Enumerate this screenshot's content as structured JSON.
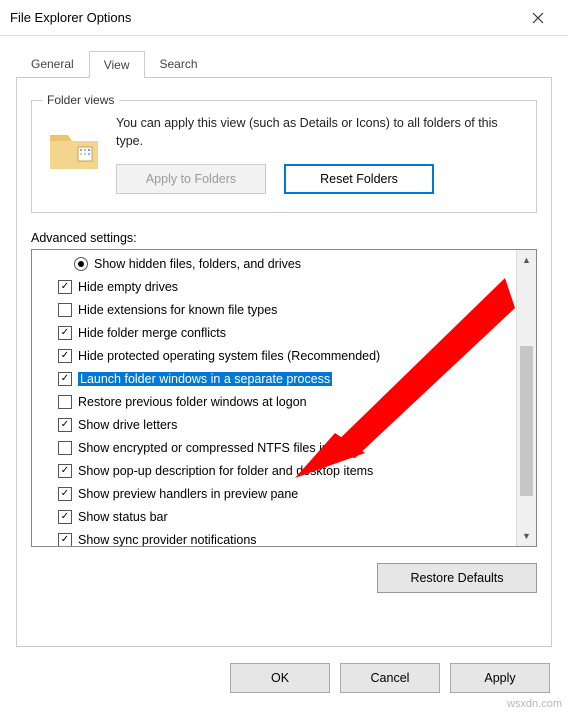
{
  "window": {
    "title": "File Explorer Options"
  },
  "tabs": {
    "general": "General",
    "view": "View",
    "search": "Search",
    "active": "view"
  },
  "folderViews": {
    "title": "Folder views",
    "text": "You can apply this view (such as Details or Icons) to all folders of this type.",
    "applyBtn": "Apply to Folders",
    "resetBtn": "Reset Folders"
  },
  "advanced": {
    "label": "Advanced settings:",
    "items": [
      {
        "kind": "radio",
        "checked": true,
        "label": "Show hidden files, folders, and drives",
        "selected": false
      },
      {
        "kind": "check",
        "checked": true,
        "label": "Hide empty drives",
        "selected": false
      },
      {
        "kind": "check",
        "checked": false,
        "label": "Hide extensions for known file types",
        "selected": false
      },
      {
        "kind": "check",
        "checked": true,
        "label": "Hide folder merge conflicts",
        "selected": false
      },
      {
        "kind": "check",
        "checked": true,
        "label": "Hide protected operating system files (Recommended)",
        "selected": false
      },
      {
        "kind": "check",
        "checked": true,
        "label": "Launch folder windows in a separate process",
        "selected": true
      },
      {
        "kind": "check",
        "checked": false,
        "label": "Restore previous folder windows at logon",
        "selected": false
      },
      {
        "kind": "check",
        "checked": true,
        "label": "Show drive letters",
        "selected": false
      },
      {
        "kind": "check",
        "checked": false,
        "label": "Show encrypted or compressed NTFS files in color",
        "selected": false
      },
      {
        "kind": "check",
        "checked": true,
        "label": "Show pop-up description for folder and desktop items",
        "selected": false
      },
      {
        "kind": "check",
        "checked": true,
        "label": "Show preview handlers in preview pane",
        "selected": false
      },
      {
        "kind": "check",
        "checked": true,
        "label": "Show status bar",
        "selected": false
      },
      {
        "kind": "check",
        "checked": true,
        "label": "Show sync provider notifications",
        "selected": false
      }
    ],
    "restoreBtn": "Restore Defaults"
  },
  "dialog": {
    "ok": "OK",
    "cancel": "Cancel",
    "apply": "Apply"
  },
  "watermark": "wsxdn.com",
  "arrow_color": "#ff0000"
}
